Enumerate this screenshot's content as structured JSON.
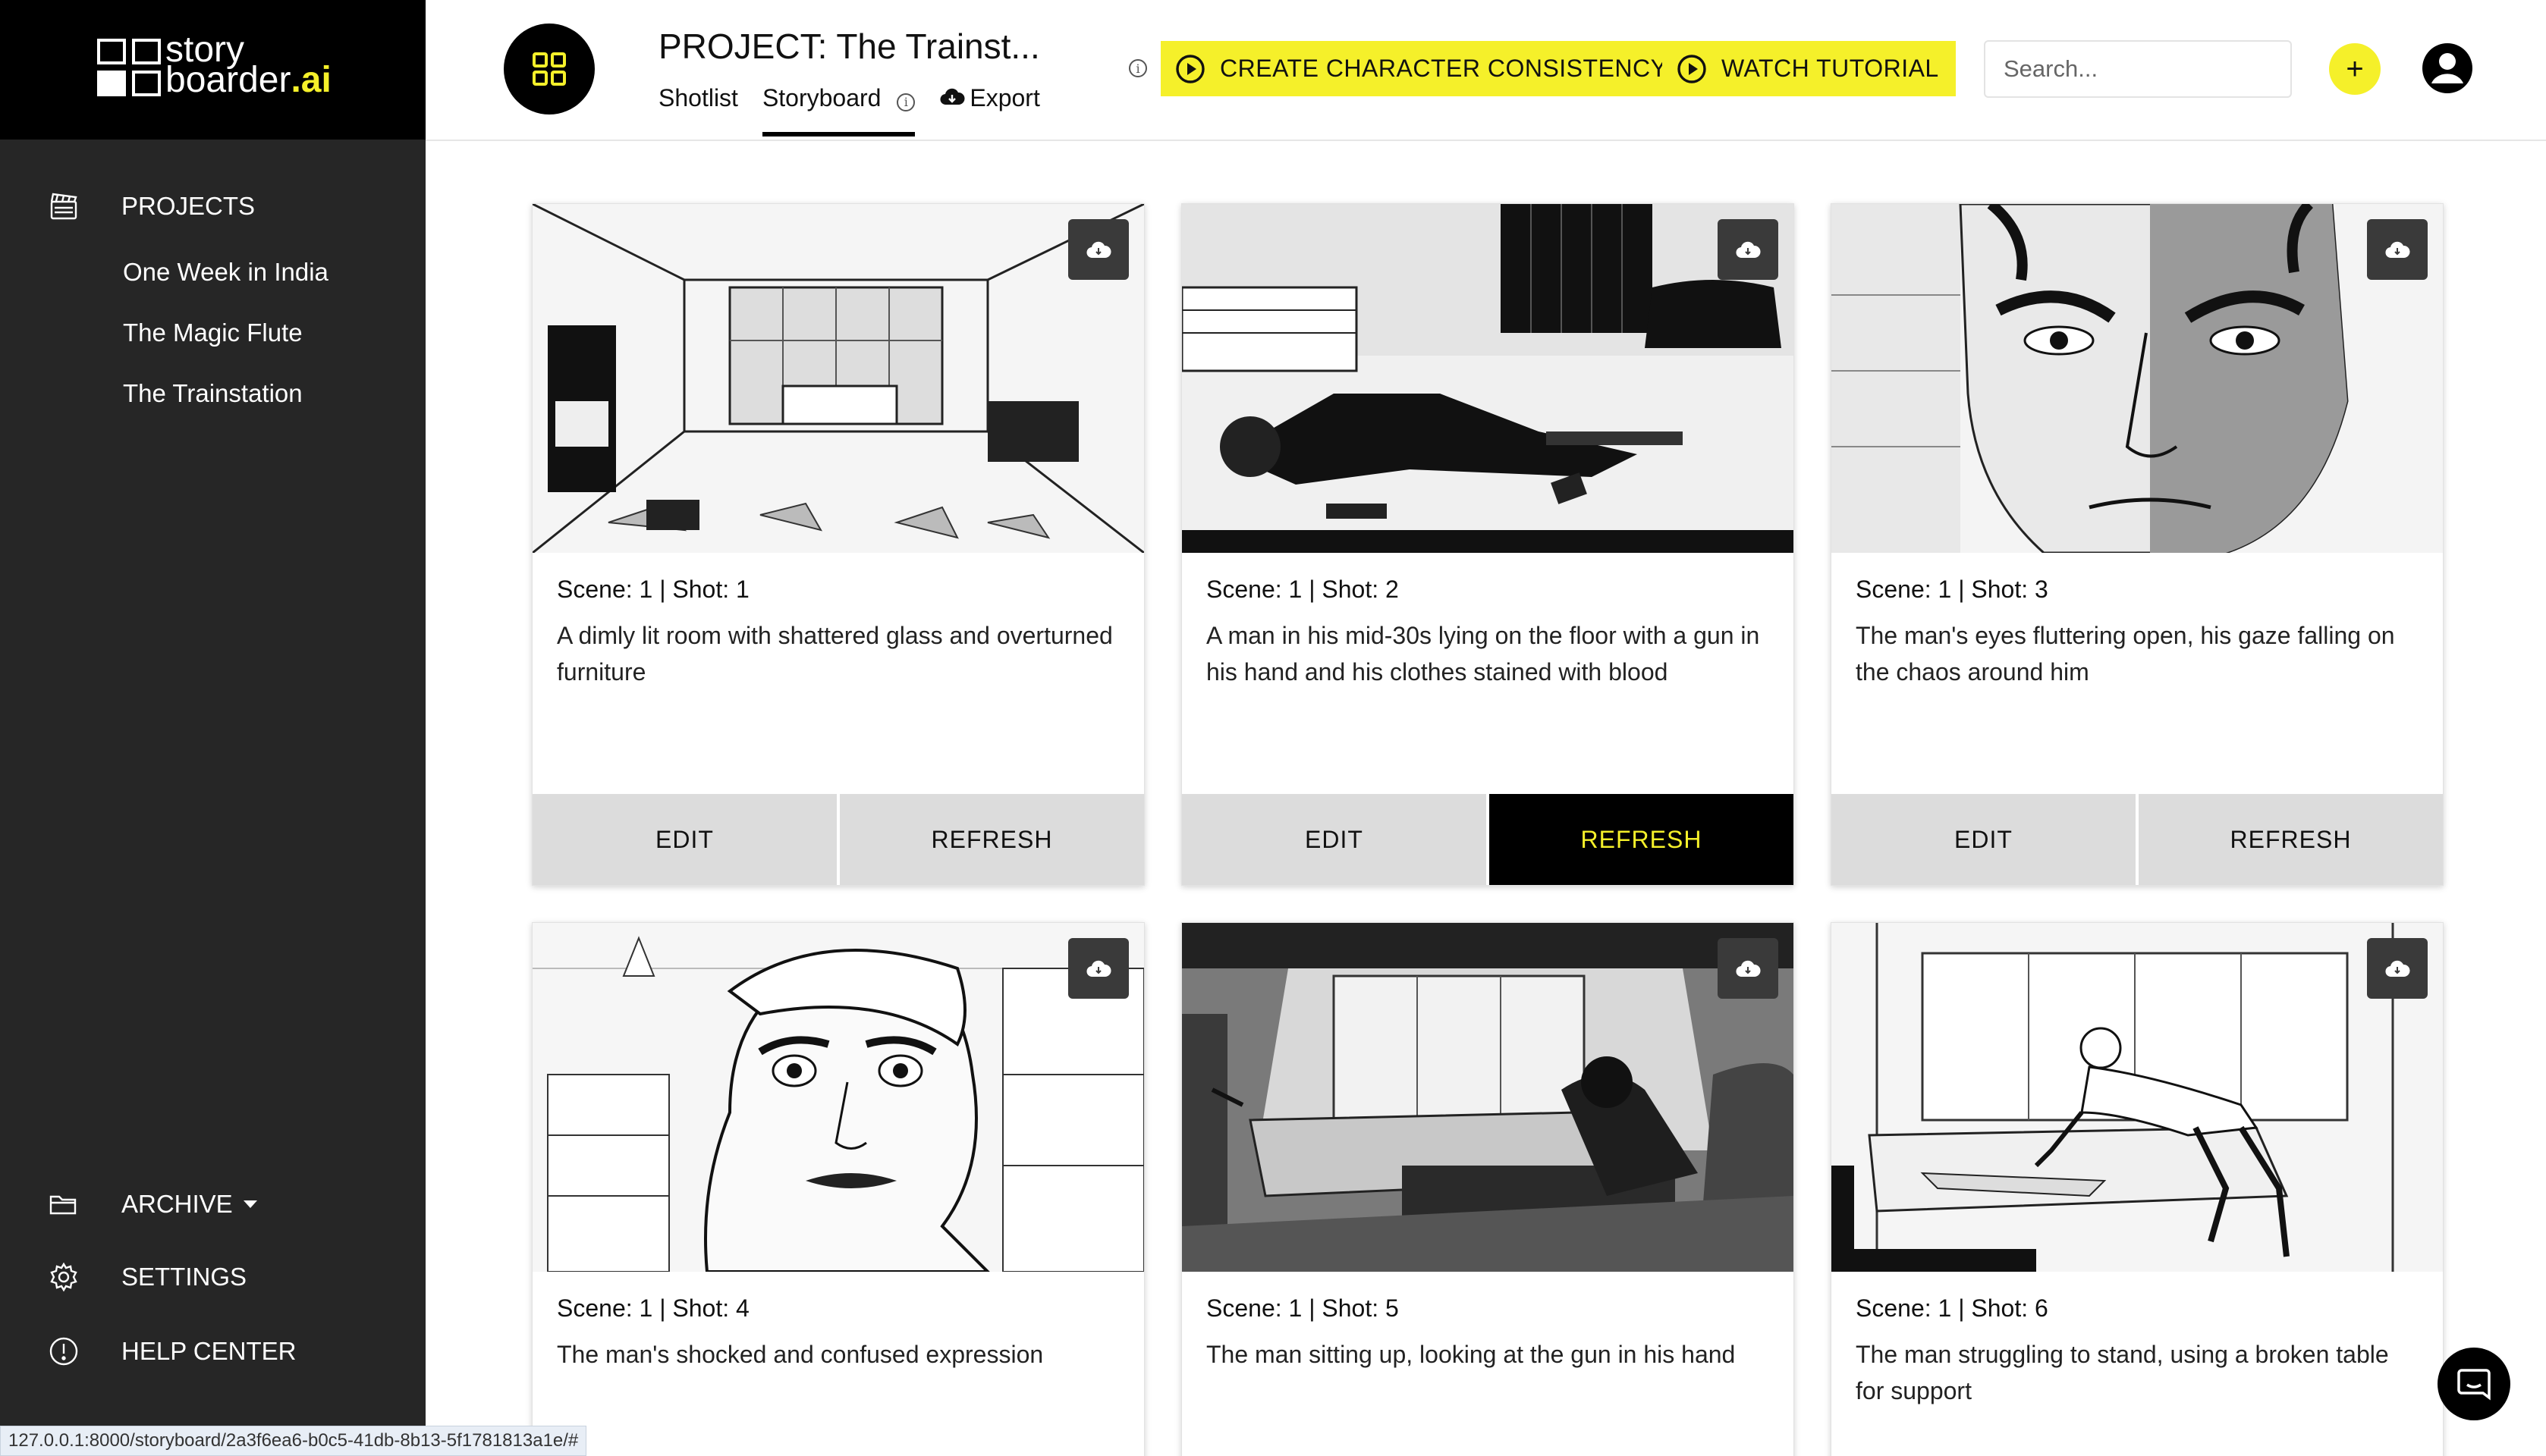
{
  "brand": {
    "name_top": "story",
    "name_bottom": "boarder",
    "name_ai": ".ai"
  },
  "sidebar": {
    "projects_label": "PROJECTS",
    "projects": [
      "One Week in India",
      "The Magic Flute",
      "The Trainstation"
    ],
    "archive_label": "ARCHIVE",
    "settings_label": "SETTINGS",
    "help_label": "HELP CENTER"
  },
  "header": {
    "title": "PROJECT: The Trainst...",
    "tabs": [
      "Shotlist",
      "Storyboard",
      "Export"
    ],
    "active_tab": "Storyboard",
    "btn_consistency": "CREATE CHARACTER CONSISTENCY",
    "btn_tutorial": "WATCH TUTORIAL",
    "search_placeholder": "Search...",
    "plus": "+"
  },
  "colors": {
    "accent": "#f5f02a",
    "sidebar": "#262626",
    "black": "#000000"
  },
  "shots": [
    {
      "title": "Scene: 1 | Shot: 1",
      "desc": "A dimly lit room with shattered glass and overturned furniture",
      "edit": "EDIT",
      "refresh": "REFRESH"
    },
    {
      "title": "Scene: 1 | Shot: 2",
      "desc": "A man in his mid-30s lying on the floor with a gun in his hand and his clothes stained with blood",
      "edit": "EDIT",
      "refresh": "REFRESH"
    },
    {
      "title": "Scene: 1 | Shot: 3",
      "desc": "The man's eyes fluttering open, his gaze falling on the chaos around him",
      "edit": "EDIT",
      "refresh": "REFRESH"
    },
    {
      "title": "Scene: 1 | Shot: 4",
      "desc": "The man's shocked and confused expression"
    },
    {
      "title": "Scene: 1 | Shot: 5",
      "desc": "The man sitting up, looking at the gun in his hand"
    },
    {
      "title": "Scene: 1 | Shot: 6",
      "desc": "The man struggling to stand, using a broken table for support"
    }
  ],
  "status_url": "127.0.0.1:8000/storyboard/2a3f6ea6-b0c5-41db-8b13-5f1781813a1e/#"
}
